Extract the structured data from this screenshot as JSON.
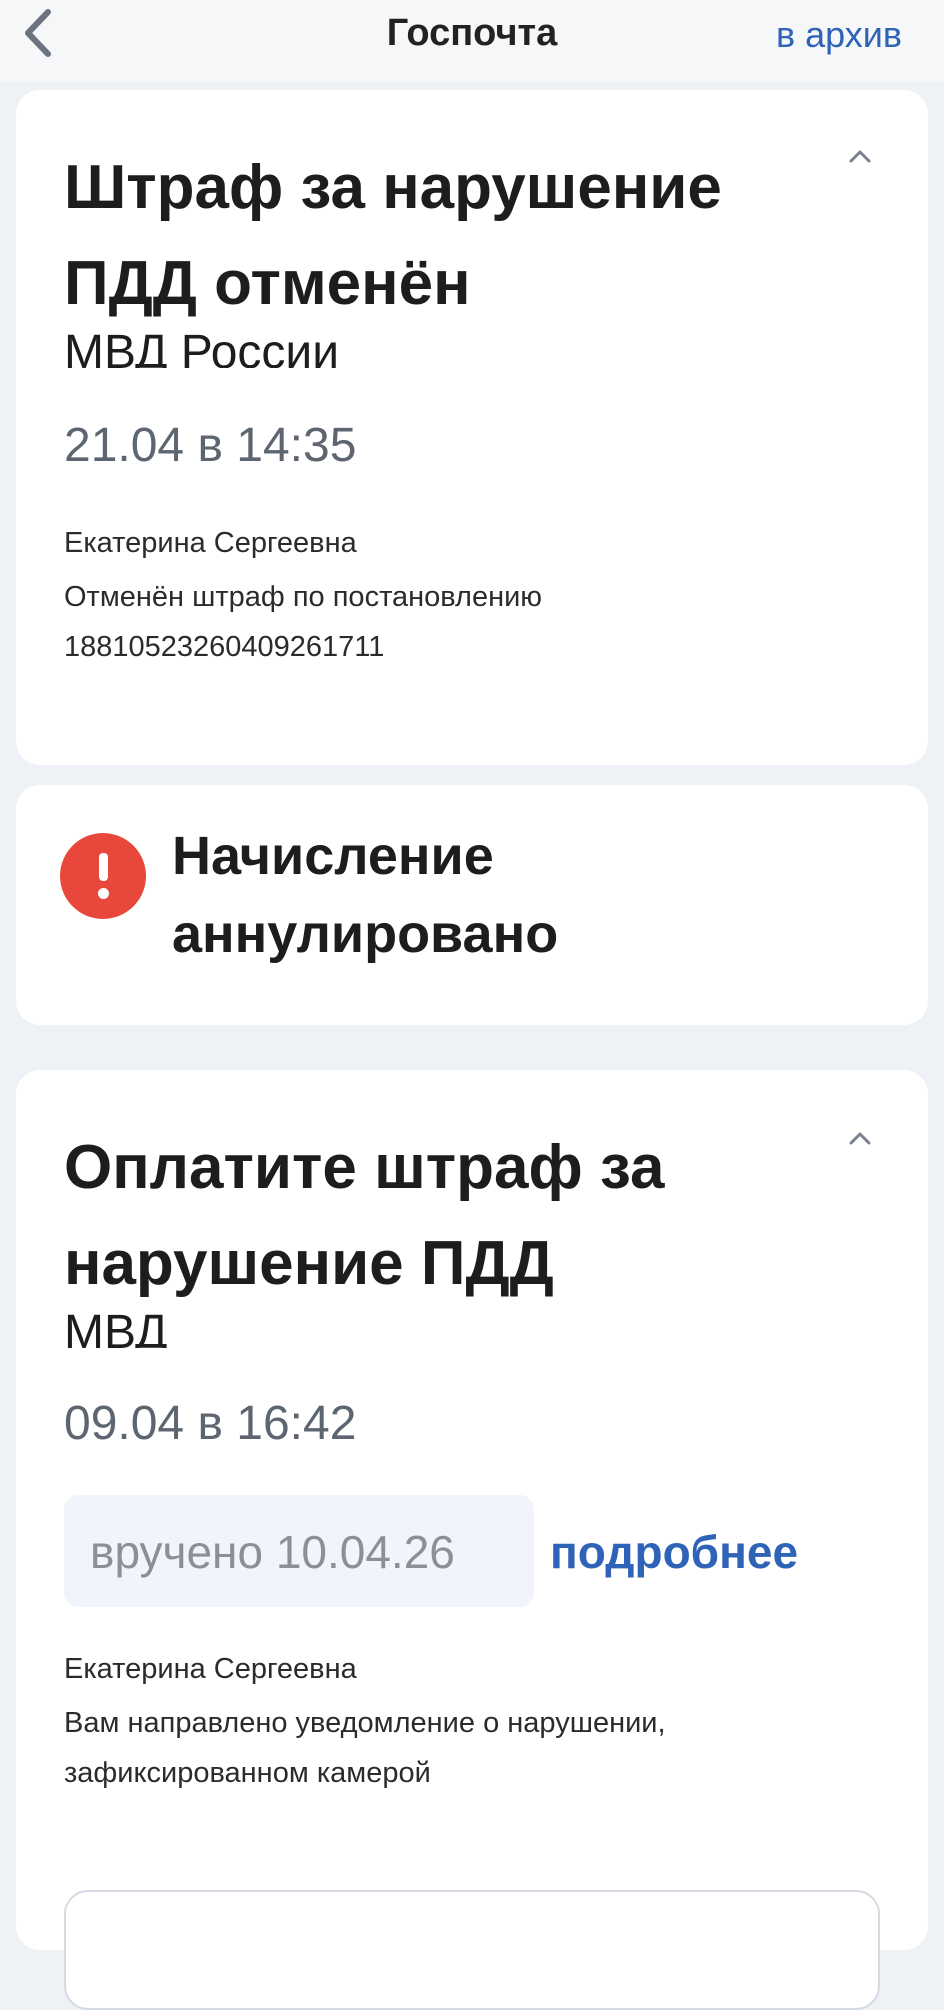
{
  "header": {
    "title": "Госпочта",
    "archive_label": "в архив",
    "back_icon": "chevron-left-icon"
  },
  "messages": [
    {
      "title": "Штраф за нарушение ПДД отменён",
      "sender": "МВД России",
      "datetime": "21.04 в 14:35",
      "recipient": "Екатерина Сергеевна",
      "body": "Отменён штраф по постановлению 18810523260409261711"
    },
    {
      "title": "Оплатите штраф за нарушение ПДД",
      "sender": "МВД",
      "datetime": "09.04 в 16:42",
      "delivered": "вручено 10.04.26",
      "details_label": "подробнее",
      "recipient": "Екатерина Сергеевна",
      "body": "Вам направлено уведомление о нарушении, зафиксированном камерой"
    }
  ],
  "status": {
    "text": "Начисление аннулировано",
    "icon": "alert-icon",
    "color": "#e8483b"
  },
  "colors": {
    "accent": "#2f63b7",
    "background": "#eef1f5",
    "alert": "#e8483b"
  }
}
